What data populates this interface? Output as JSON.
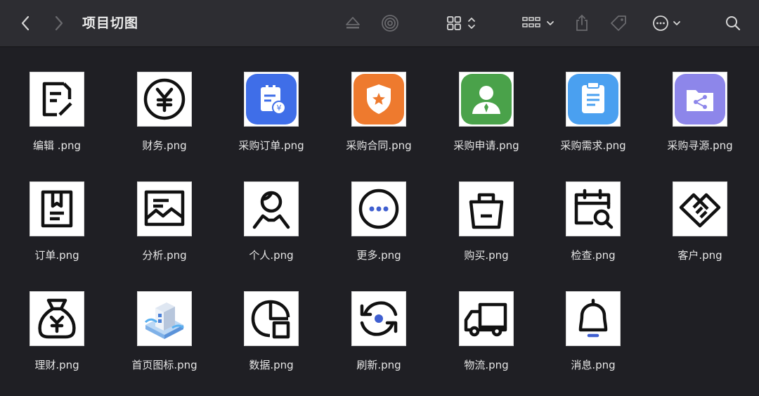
{
  "window": {
    "title": "项目切图"
  },
  "toolbar": {
    "back_icon": "chevron-left-icon",
    "forward_icon": "chevron-right-icon",
    "eject_icon": "eject-icon",
    "airdrop_icon": "airdrop-icon",
    "view_icon": "grid-view-icon",
    "group_icon": "group-by-icon",
    "share_icon": "share-icon",
    "tag_icon": "tag-icon",
    "more_icon": "ellipsis-circle-icon",
    "search_icon": "search-icon"
  },
  "files": [
    {
      "name": "编辑 .png",
      "icon": "edit-icon"
    },
    {
      "name": "财务.png",
      "icon": "yen-circle-icon"
    },
    {
      "name": "采购订单.png",
      "icon": "purchase-order-icon"
    },
    {
      "name": "采购合同.png",
      "icon": "contract-shield-icon"
    },
    {
      "name": "采购申请.png",
      "icon": "applicant-icon"
    },
    {
      "name": "采购需求.png",
      "icon": "clipboard-icon"
    },
    {
      "name": "采购寻源.png",
      "icon": "folder-share-icon"
    },
    {
      "name": "订单.png",
      "icon": "order-icon"
    },
    {
      "name": "分析.png",
      "icon": "analysis-icon"
    },
    {
      "name": "个人.png",
      "icon": "person-icon"
    },
    {
      "name": "更多.png",
      "icon": "more-icon"
    },
    {
      "name": "购买.png",
      "icon": "shopping-bag-icon"
    },
    {
      "name": "检查.png",
      "icon": "calendar-search-icon"
    },
    {
      "name": "客户.png",
      "icon": "handshake-icon"
    },
    {
      "name": "理财.png",
      "icon": "money-bag-icon"
    },
    {
      "name": "首页图标.png",
      "icon": "home-3d-icon"
    },
    {
      "name": "数据.png",
      "icon": "data-icon"
    },
    {
      "name": "刷新.png",
      "icon": "refresh-icon"
    },
    {
      "name": "物流.png",
      "icon": "truck-icon"
    },
    {
      "name": "消息.png",
      "icon": "bell-icon"
    }
  ],
  "colors": {
    "background": "#1f1f24",
    "toolbar": "#2d2d32",
    "blue": "#3f6ee8",
    "orange": "#ee7a2e",
    "green": "#4aa24a",
    "light_blue": "#4aa0f0",
    "purple": "#8d86ea"
  }
}
